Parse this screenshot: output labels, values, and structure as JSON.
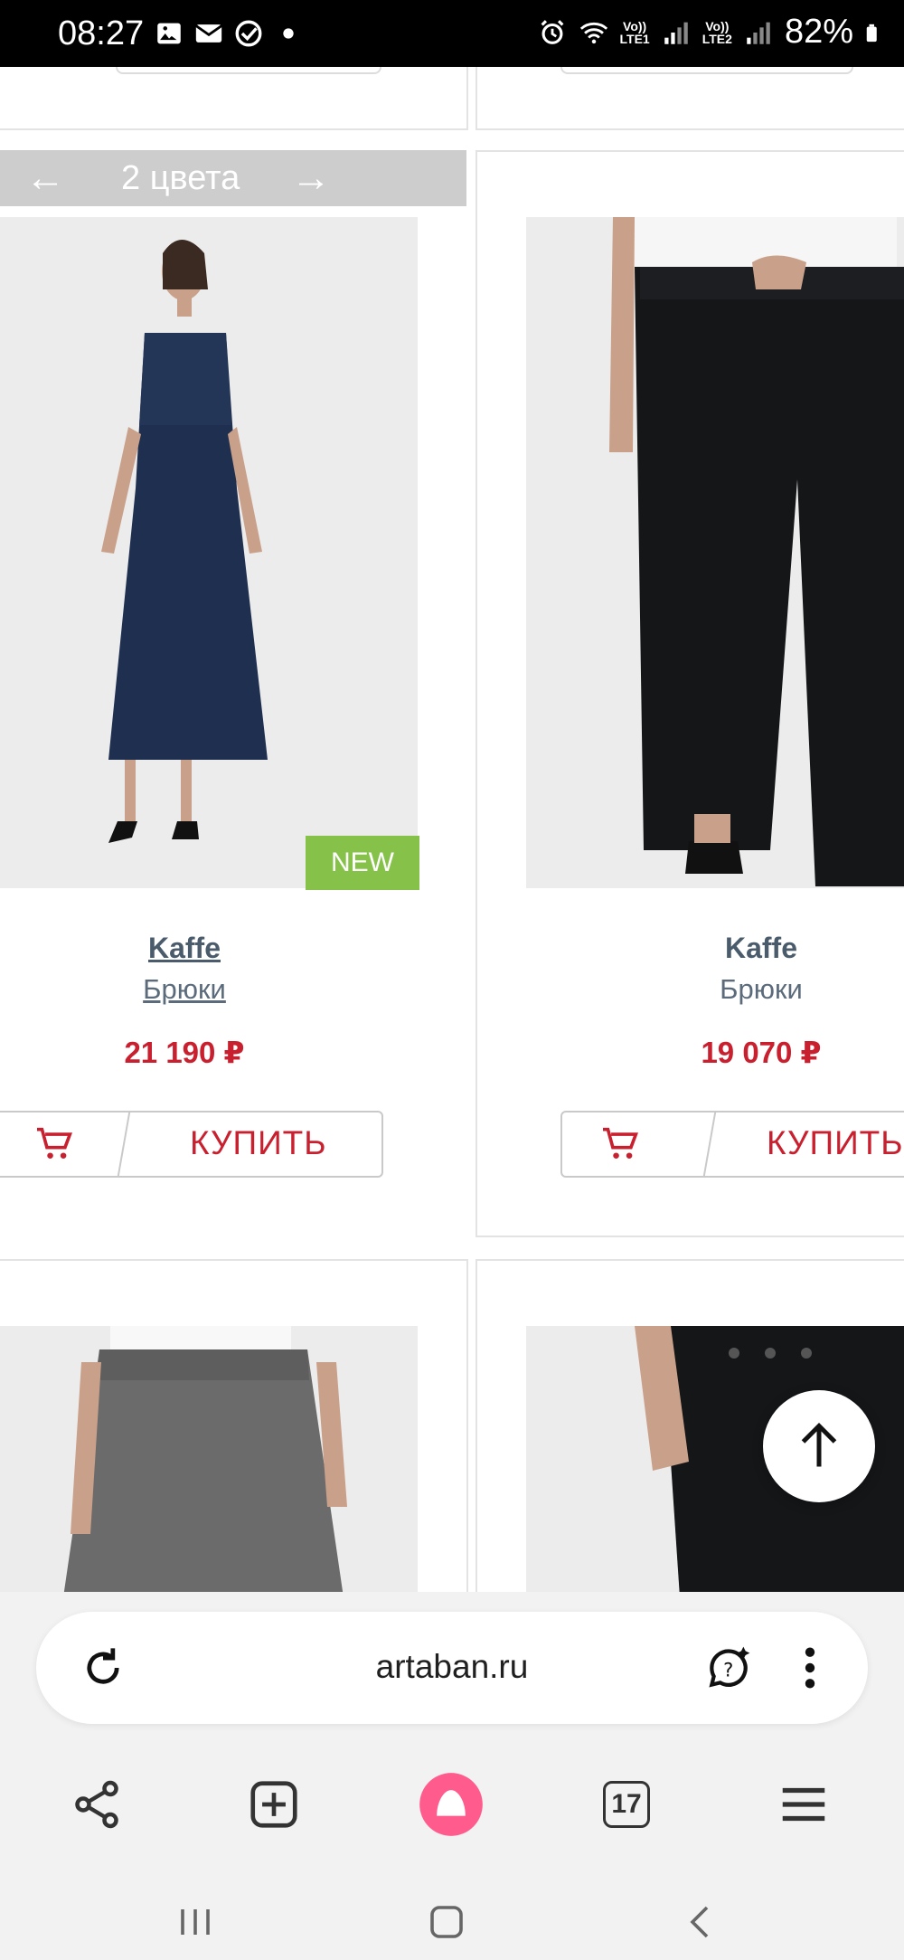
{
  "status_bar": {
    "time": "08:27",
    "battery": "82%",
    "sim1": "LTE1",
    "sim2": "LTE2",
    "volte": "Vo))"
  },
  "products": [
    {
      "brand": "Kaffe",
      "category": "Брюки",
      "price": "21 190 ₽",
      "buy_label": "КУПИТЬ",
      "badge": "NEW",
      "colors_label": "2 цвета"
    },
    {
      "brand": "Kaffe",
      "category": "Брюки",
      "price": "19 070 ₽",
      "buy_label": "КУПИТЬ"
    }
  ],
  "browser": {
    "url": "artaban.ru",
    "tabs_count": "17"
  },
  "colors": {
    "price_red": "#c8202f",
    "new_badge": "#86c24a",
    "alice_pink": "#ff5c8d"
  },
  "icons": [
    "share-icon",
    "new-tab-icon",
    "alice-icon",
    "tabs-icon",
    "menu-icon",
    "reload-icon",
    "ai-chat-icon",
    "more-icon",
    "scroll-top-icon",
    "cart-icon"
  ]
}
